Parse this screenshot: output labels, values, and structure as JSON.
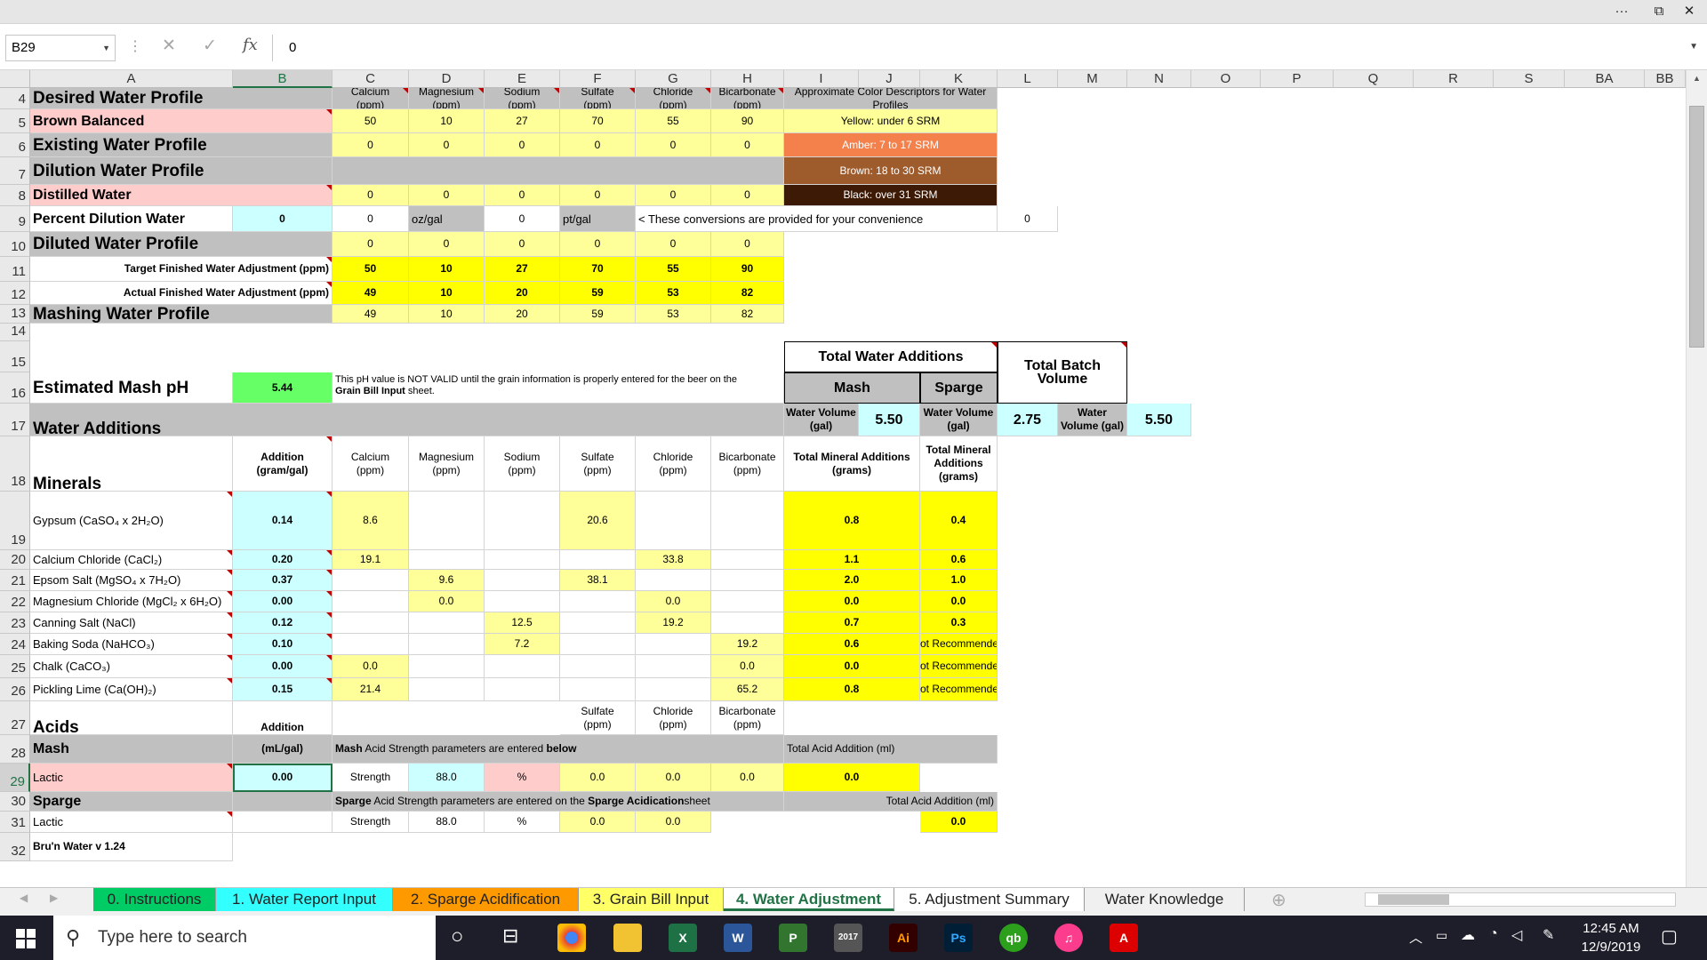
{
  "window": {
    "more": "···",
    "restore": "⧉",
    "close": "✕"
  },
  "formula_bar": {
    "name_box": "B29",
    "cancel": "✕",
    "enter": "✓",
    "fx": "fx",
    "value": "0"
  },
  "columns": [
    "A",
    "B",
    "C",
    "D",
    "E",
    "F",
    "G",
    "H",
    "I",
    "J",
    "K",
    "L",
    "M",
    "N",
    "O",
    "P",
    "Q",
    "R",
    "S",
    "BA",
    "BB"
  ],
  "rows": [
    "4",
    "5",
    "6",
    "7",
    "8",
    "9",
    "10",
    "11",
    "12",
    "13",
    "14",
    "15",
    "16",
    "17",
    "18",
    "19",
    "20",
    "21",
    "22",
    "23",
    "24",
    "25",
    "26",
    "27",
    "28",
    "29",
    "30",
    "31",
    "32"
  ],
  "hdr": {
    "ca": "Calcium\n(ppm)",
    "mg": "Magnesium\n(ppm)",
    "na": "Sodium\n(ppm)",
    "so4": "Sulfate\n(ppm)",
    "cl": "Chloride\n(ppm)",
    "hco3": "Bicarbonate\n(ppm)",
    "color_desc": "Approximate Color Descriptors for Water Profiles"
  },
  "profiles": {
    "desired": "Desired Water Profile",
    "brown": {
      "label": "Brown Balanced",
      "v": [
        "50",
        "10",
        "27",
        "70",
        "55",
        "90"
      ]
    },
    "existing": {
      "label": "Existing Water Profile",
      "v": [
        "0",
        "0",
        "0",
        "0",
        "0",
        "0"
      ]
    },
    "dilution": "Dilution Water Profile",
    "distilled": {
      "label": "Distilled Water",
      "v": [
        "0",
        "0",
        "0",
        "0",
        "0",
        "0"
      ]
    },
    "pct": {
      "label": "Percent Dilution Water",
      "b": "0",
      "c": "0",
      "d": "oz/gal",
      "e": "0",
      "f": "pt/gal",
      "note": "< These conversions are provided for your convenience",
      "l": "0"
    },
    "diluted": {
      "label": "Diluted Water Profile",
      "v": [
        "0",
        "0",
        "0",
        "0",
        "0",
        "0"
      ]
    },
    "target": {
      "label": "Target Finished Water Adjustment (ppm)",
      "v": [
        "50",
        "10",
        "27",
        "70",
        "55",
        "90"
      ]
    },
    "actual": {
      "label": "Actual Finished Water Adjustment (ppm)",
      "v": [
        "49",
        "10",
        "20",
        "59",
        "53",
        "82"
      ]
    },
    "mashing": {
      "label": "Mashing Water Profile",
      "v": [
        "49",
        "10",
        "20",
        "59",
        "53",
        "82"
      ]
    }
  },
  "srm": {
    "yellow": "Yellow: under 6 SRM",
    "amber": "Amber: 7 to 17 SRM",
    "brown": "Brown: 18 to 30 SRM",
    "black": "Black: over 31 SRM",
    "c_yellow": "#ffff99",
    "c_amber": "#f4814c",
    "c_brown": "#9e5b2c",
    "c_black": "#3c1a06"
  },
  "totals": {
    "title": "Total Water Additions",
    "mash": "Mash",
    "sparge": "Sparge",
    "batch": "Total Batch Volume",
    "wv": "Water Volume (gal)",
    "mash_v": "5.50",
    "sparge_v": "2.75",
    "batch_v": "5.50"
  },
  "mash_ph": {
    "label": "Estimated Mash pH",
    "value": "5.44",
    "note1": "This pH value is NOT VALID until the grain information is properly entered for the beer on the",
    "note2": "Grain Bill Input",
    "note3": " sheet."
  },
  "additions": {
    "title": "Water Additions",
    "minerals": "Minerals",
    "addition_hdr": "Addition\n(gram/gal)",
    "tot_min": "Total Mineral Additions\n(grams)"
  },
  "minerals": [
    {
      "name": "Gypsum (CaSO₄ x 2H₂O)",
      "add": "0.14",
      "ca": "8.6",
      "mg": "",
      "na": "",
      "so4": "20.6",
      "cl": "",
      "hco3": "",
      "mash": "0.8",
      "sparge": "0.4"
    },
    {
      "name": "Calcium Chloride (CaCl₂)",
      "add": "0.20",
      "ca": "19.1",
      "mg": "",
      "na": "",
      "so4": "",
      "cl": "33.8",
      "hco3": "",
      "mash": "1.1",
      "sparge": "0.6"
    },
    {
      "name": "Epsom Salt (MgSO₄ x 7H₂O)",
      "add": "0.37",
      "ca": "",
      "mg": "9.6",
      "na": "",
      "so4": "38.1",
      "cl": "",
      "hco3": "",
      "mash": "2.0",
      "sparge": "1.0"
    },
    {
      "name": "Magnesium Chloride (MgCl₂ x 6H₂O)",
      "add": "0.00",
      "ca": "",
      "mg": "0.0",
      "na": "",
      "so4": "",
      "cl": "0.0",
      "hco3": "",
      "mash": "0.0",
      "sparge": "0.0"
    },
    {
      "name": "Canning Salt (NaCl)",
      "add": "0.12",
      "ca": "",
      "mg": "",
      "na": "12.5",
      "so4": "",
      "cl": "19.2",
      "hco3": "",
      "mash": "0.7",
      "sparge": "0.3"
    },
    {
      "name": "Baking Soda (NaHCO₃)",
      "add": "0.10",
      "ca": "",
      "mg": "",
      "na": "7.2",
      "so4": "",
      "cl": "",
      "hco3": "19.2",
      "mash": "0.6",
      "sparge": "Not Recommended"
    },
    {
      "name": "Chalk (CaCO₃)",
      "add": "0.00",
      "ca": "0.0",
      "mg": "",
      "na": "",
      "so4": "",
      "cl": "",
      "hco3": "0.0",
      "mash": "0.0",
      "sparge": "Not Recommended"
    },
    {
      "name": "Pickling Lime (Ca(OH)₂)",
      "add": "0.15",
      "ca": "21.4",
      "mg": "",
      "na": "",
      "so4": "",
      "cl": "",
      "hco3": "65.2",
      "mash": "0.8",
      "sparge": "Not Recommended"
    }
  ],
  "acids": {
    "title": "Acids",
    "addition": "Addition",
    "mash": "Mash",
    "ml_gal": "(mL/gal)",
    "mash_note_a": "Mash",
    "mash_note_b": " Acid Strength parameters are entered ",
    "mash_note_c": "below",
    "tot_acid": "Total Acid Addition (ml)",
    "sparge": "Sparge",
    "sparge_note_a": "Sparge",
    "sparge_note_b": " Acid Strength parameters are entered on the ",
    "sparge_note_c": "Sparge Acidication",
    "sparge_note_d": " sheet",
    "tot_acid2": "Total Acid Addition (ml)",
    "mash_row": {
      "acid": "Lactic",
      "add": "0.00",
      "strength": "Strength",
      "pct": "88.0",
      "unit": "%",
      "so4": "0.0",
      "cl": "0.0",
      "hco3": "0.0",
      "total": "0.0"
    },
    "sparge_row": {
      "acid": "Lactic",
      "add": "",
      "strength": "Strength",
      "pct": "88.0",
      "unit": "%",
      "so4": "0.0",
      "cl": "0.0",
      "total": "0.0"
    }
  },
  "version": "Bru'n Water v 1.24",
  "tabs": [
    {
      "label": "0. Instructions",
      "color": "#00cc66"
    },
    {
      "label": "1. Water Report Input",
      "color": "#33ffff"
    },
    {
      "label": "2. Sparge Acidification",
      "color": "#ff9900"
    },
    {
      "label": "3. Grain Bill Input",
      "color": "#ffff66"
    },
    {
      "label": "4. Water Adjustment",
      "color": "#ffffff"
    },
    {
      "label": "5. Adjustment Summary",
      "color": "#ffffff"
    },
    {
      "label": "Water Knowledge",
      "color": "#f0f0f0"
    }
  ],
  "taskbar": {
    "search": "Type here to search",
    "time": "12:45 AM",
    "date": "12/9/2019",
    "icons": [
      "chrome-icon",
      "file-explorer-icon",
      "excel-icon",
      "word-icon",
      "project-icon",
      "turbocad-icon",
      "illustrator-icon",
      "photoshop-icon",
      "quickbooks-icon",
      "itunes-icon",
      "acrobat-icon"
    ],
    "labels": {
      "excel": "X",
      "word": "W",
      "project": "P",
      "turbocad": "2017",
      "ai": "Ai",
      "ps": "Ps",
      "qb": "qb",
      "pdf": "A"
    }
  }
}
